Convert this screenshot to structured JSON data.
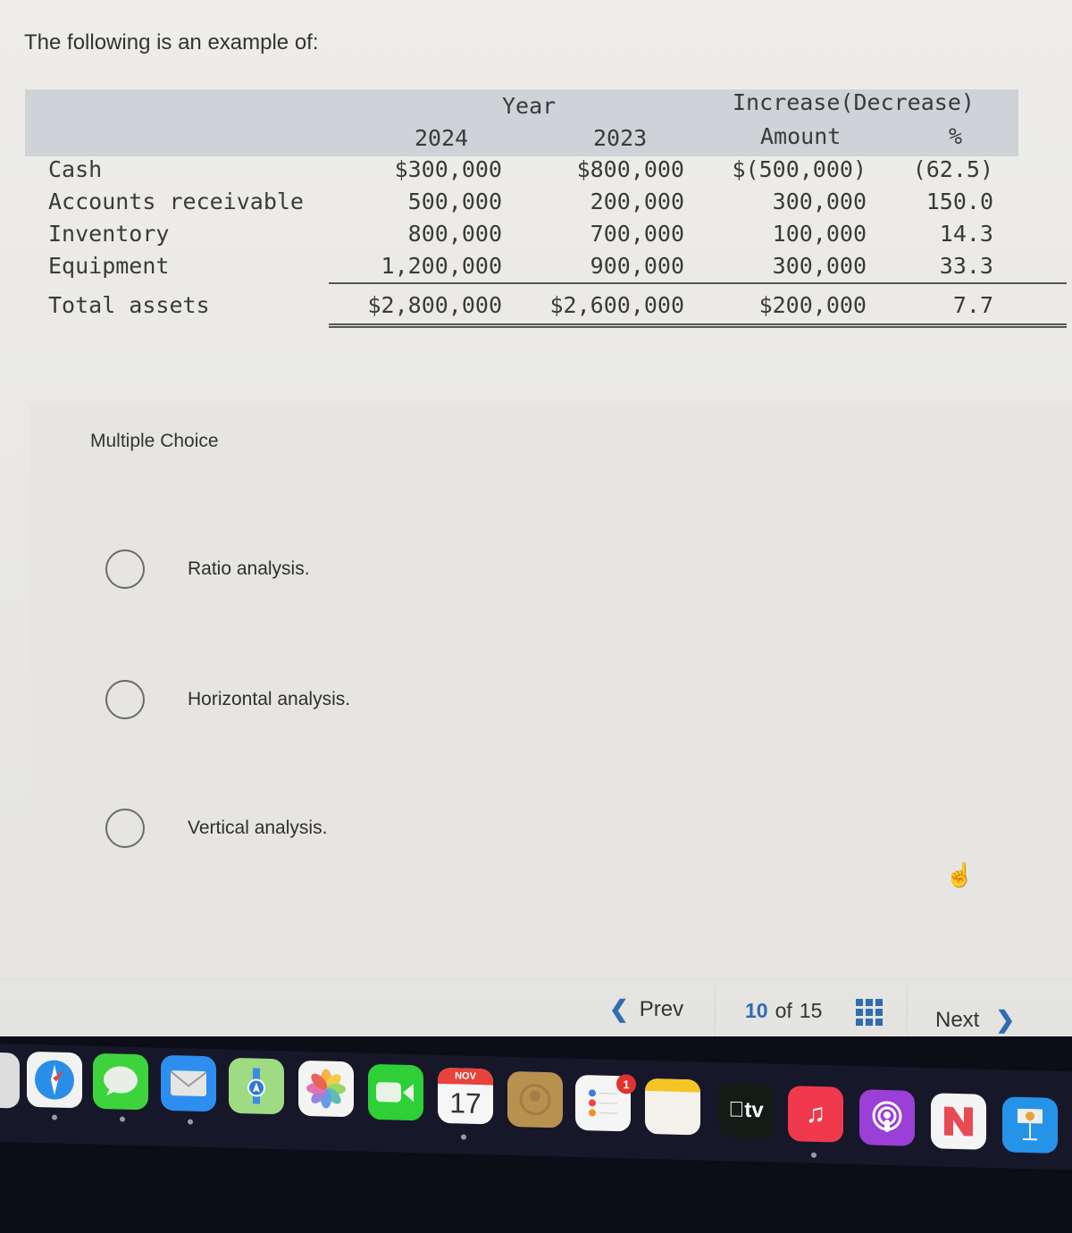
{
  "question": {
    "prompt": "The following is an example of:"
  },
  "table": {
    "header": {
      "group_year": "Year",
      "group_change": "Increase(Decrease)",
      "col_2024": "2024",
      "col_2023": "2023",
      "col_amount": "Amount",
      "col_pct": "%"
    },
    "rows": [
      {
        "label": "Cash",
        "y2024": "$300,000",
        "y2023": "$800,000",
        "amount": "$(500,000)",
        "pct": "(62.5)"
      },
      {
        "label": "Accounts receivable",
        "y2024": "500,000",
        "y2023": "200,000",
        "amount": "300,000",
        "pct": "150.0"
      },
      {
        "label": "Inventory",
        "y2024": "800,000",
        "y2023": "700,000",
        "amount": "100,000",
        "pct": "14.3"
      },
      {
        "label": "Equipment",
        "y2024": "1,200,000",
        "y2023": "900,000",
        "amount": "300,000",
        "pct": "33.3"
      }
    ],
    "total": {
      "label": "Total assets",
      "y2024": "$2,800,000",
      "y2023": "$2,600,000",
      "amount": "$200,000",
      "pct": "7.7"
    }
  },
  "multiple_choice": {
    "title": "Multiple Choice",
    "options": [
      {
        "label": "Ratio analysis.",
        "selected": false
      },
      {
        "label": "Horizontal analysis.",
        "selected": false
      },
      {
        "label": "Vertical analysis.",
        "selected": false
      }
    ]
  },
  "navigation": {
    "prev_label": "Prev",
    "next_label": "Next",
    "current_page": "10",
    "of_label": "of",
    "total_pages": "15",
    "accent_color": "#2f6cb3"
  },
  "dock": {
    "apps": [
      {
        "name": "Launchpad",
        "icon": "launchpad-icon"
      },
      {
        "name": "Safari",
        "icon": "safari-icon"
      },
      {
        "name": "Messages",
        "icon": "messages-icon"
      },
      {
        "name": "Mail",
        "icon": "mail-icon"
      },
      {
        "name": "Maps",
        "icon": "maps-icon"
      },
      {
        "name": "Photos",
        "icon": "photos-icon"
      },
      {
        "name": "FaceTime",
        "icon": "facetime-icon"
      },
      {
        "name": "Calendar",
        "icon": "calendar-icon",
        "month": "NOV",
        "day": "17"
      },
      {
        "name": "Contacts",
        "icon": "contacts-icon"
      },
      {
        "name": "Reminders",
        "icon": "reminders-icon",
        "badge": "1"
      },
      {
        "name": "Notes",
        "icon": "notes-icon"
      },
      {
        "name": "TV",
        "icon": "tv-icon",
        "label": "tv"
      },
      {
        "name": "Music",
        "icon": "music-icon"
      },
      {
        "name": "Podcasts",
        "icon": "podcasts-icon"
      },
      {
        "name": "News",
        "icon": "news-icon"
      },
      {
        "name": "Keynote",
        "icon": "keynote-icon"
      }
    ]
  }
}
